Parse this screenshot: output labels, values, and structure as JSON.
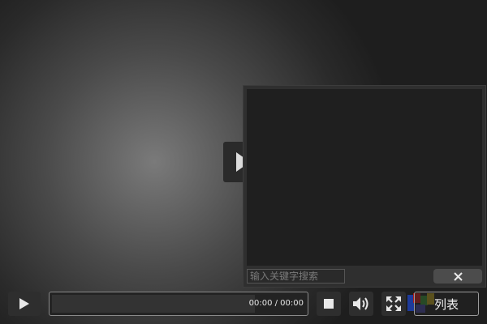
{
  "player": {
    "center_play_icon": "play-icon",
    "colors": {
      "background": "#1e1e1e",
      "control_bg": "#2e2e2e",
      "text": "#e6e6e6"
    }
  },
  "playlist": {
    "search_placeholder": "输入关键字搜索",
    "close_icon": "close-icon"
  },
  "controls": {
    "play_icon": "play-icon",
    "time_display": "00:00 / 00:00",
    "progress": 0,
    "stop_icon": "stop-icon",
    "volume_icon": "volume-icon",
    "fullscreen_icon": "fullscreen-icon",
    "list_label": "列表"
  }
}
